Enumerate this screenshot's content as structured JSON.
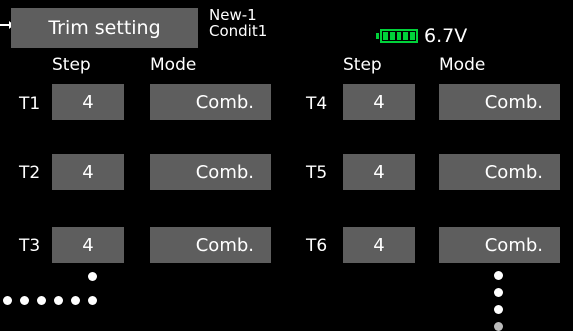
{
  "header": {
    "title": "Trim setting",
    "model_name": "New-1",
    "condition": "Condit1",
    "voltage": "6.7V",
    "battery_level": 1.0
  },
  "columns": {
    "left_step": "Step",
    "left_mode": "Mode",
    "right_step": "Step",
    "right_mode": "Mode"
  },
  "trims": [
    {
      "label": "T1",
      "step": "4",
      "mode": "Comb."
    },
    {
      "label": "T2",
      "step": "4",
      "mode": "Comb."
    },
    {
      "label": "T3",
      "step": "4",
      "mode": "Comb."
    },
    {
      "label": "T4",
      "step": "4",
      "mode": "Comb."
    },
    {
      "label": "T5",
      "step": "4",
      "mode": "Comb."
    },
    {
      "label": "T6",
      "step": "4",
      "mode": "Comb."
    }
  ],
  "colors": {
    "background": "#000000",
    "button": "#5e5e5e",
    "battery": "#00d23a",
    "text": "#ffffff"
  }
}
